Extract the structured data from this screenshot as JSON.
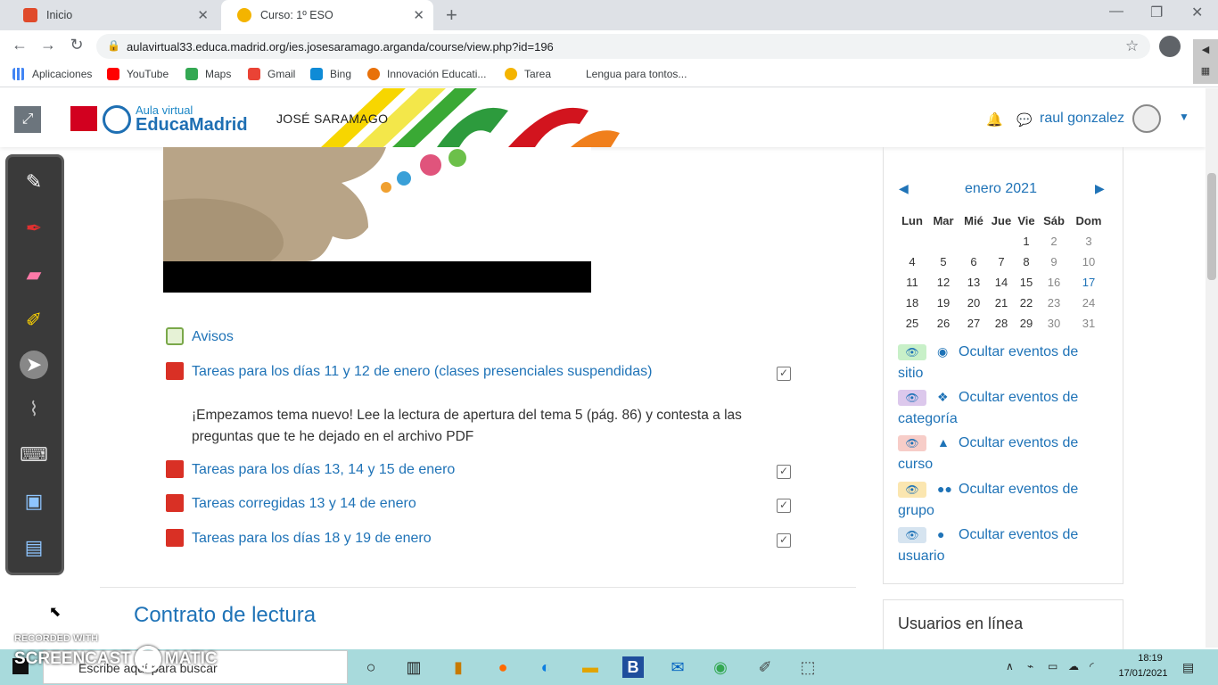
{
  "browser": {
    "tabs": [
      {
        "title": "Inicio",
        "active": false
      },
      {
        "title": "Curso: 1º ESO",
        "active": true
      }
    ],
    "url": "aulavirtual33.educa.madrid.org/ies.josesaramago.arganda/course/view.php?id=196",
    "bookmarks": [
      "Aplicaciones",
      "YouTube",
      "Maps",
      "Gmail",
      "Bing",
      "Innovación Educati...",
      "Tarea",
      "Lengua para tontos..."
    ]
  },
  "header": {
    "logo_line1": "Aula virtual",
    "logo_line2": "EducaMadrid",
    "school": "JOSÉ SARAMAGO",
    "user": "raul gonzalez"
  },
  "activities": [
    {
      "label": "Avisos",
      "type": "forum"
    },
    {
      "label": "Tareas para los días 11 y 12 de enero (clases presenciales suspendidas)",
      "type": "pdf"
    },
    {
      "label": "Tareas para los días 13, 14 y 15 de enero",
      "type": "pdf"
    },
    {
      "label": "Tareas corregidas 13 y 14 de enero",
      "type": "pdf"
    },
    {
      "label": "Tareas para los días 18 y 19 de enero",
      "type": "pdf"
    }
  ],
  "description": "¡Empezamos tema nuevo! Lee la lectura de apertura del tema 5 (pág. 86) y contesta a las preguntas que te he dejado en el archivo PDF",
  "section_title": "Contrato de lectura",
  "calendar": {
    "month": "enero 2021",
    "prev": "◀",
    "next": "▶",
    "weekdays": [
      "Lun",
      "Mar",
      "Mié",
      "Jue",
      "Vie",
      "Sáb",
      "Dom"
    ],
    "weeks": [
      [
        "",
        "",
        "",
        "",
        "1",
        "2",
        "3"
      ],
      [
        "4",
        "5",
        "6",
        "7",
        "8",
        "9",
        "10"
      ],
      [
        "11",
        "12",
        "13",
        "14",
        "15",
        "16",
        "17"
      ],
      [
        "18",
        "19",
        "20",
        "21",
        "22",
        "23",
        "24"
      ],
      [
        "25",
        "26",
        "27",
        "28",
        "29",
        "30",
        "31"
      ]
    ],
    "events": [
      {
        "line1": "Ocultar eventos de",
        "line2": "sitio",
        "icon": "globe-icon",
        "color": "#c8f0c8"
      },
      {
        "line1": "Ocultar eventos de",
        "line2": "categoría",
        "icon": "cubes-icon",
        "color": "#dcc8ec"
      },
      {
        "line1": "Ocultar eventos de",
        "line2": "curso",
        "icon": "graduation-cap-icon",
        "color": "#f7cdc8"
      },
      {
        "line1": "Ocultar eventos de",
        "line2": "grupo",
        "icon": "users-icon",
        "color": "#fbe6b0"
      },
      {
        "line1": "Ocultar eventos de",
        "line2": "usuario",
        "icon": "user-icon",
        "color": "#d6e4f0"
      }
    ]
  },
  "online_users_title": "Usuarios en línea",
  "watermark": {
    "line1": "RECORDED WITH",
    "line2": "SCREENCAST",
    "line3": "MATIC"
  },
  "taskbar": {
    "search_placeholder": "Escribe aquí para buscar",
    "time": "18:19",
    "date": "17/01/2021"
  }
}
